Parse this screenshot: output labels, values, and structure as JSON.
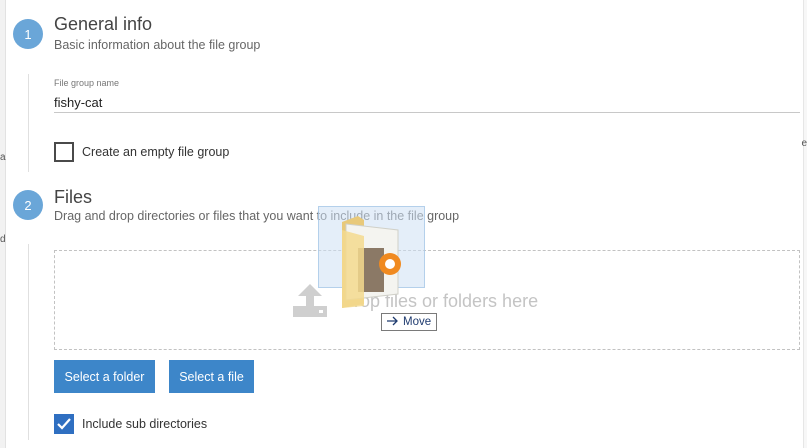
{
  "steps": [
    {
      "number": "1",
      "title": "General info",
      "subtitle": "Basic information about the file group"
    },
    {
      "number": "2",
      "title": "Files",
      "subtitle": "Drag and drop directories or files that you want to include in the file group"
    }
  ],
  "general": {
    "name_label": "File group name",
    "name_value": "fishy-cat",
    "empty_group_label": "Create an empty file group",
    "empty_group_checked": false
  },
  "files": {
    "dropzone_text": "Drop files or folders here",
    "select_folder_label": "Select a folder",
    "select_file_label": "Select a file",
    "include_subdirs_label": "Include sub directories",
    "include_subdirs_checked": true
  },
  "drag": {
    "tooltip_label": "Move",
    "arrow_icon": "arrow-right-icon"
  },
  "background_fragments": [
    "a",
    "e",
    "d"
  ],
  "colors": {
    "badge": "#6aa6d8",
    "button": "#3d86c9",
    "checkbox_checked": "#2f6fc1"
  }
}
